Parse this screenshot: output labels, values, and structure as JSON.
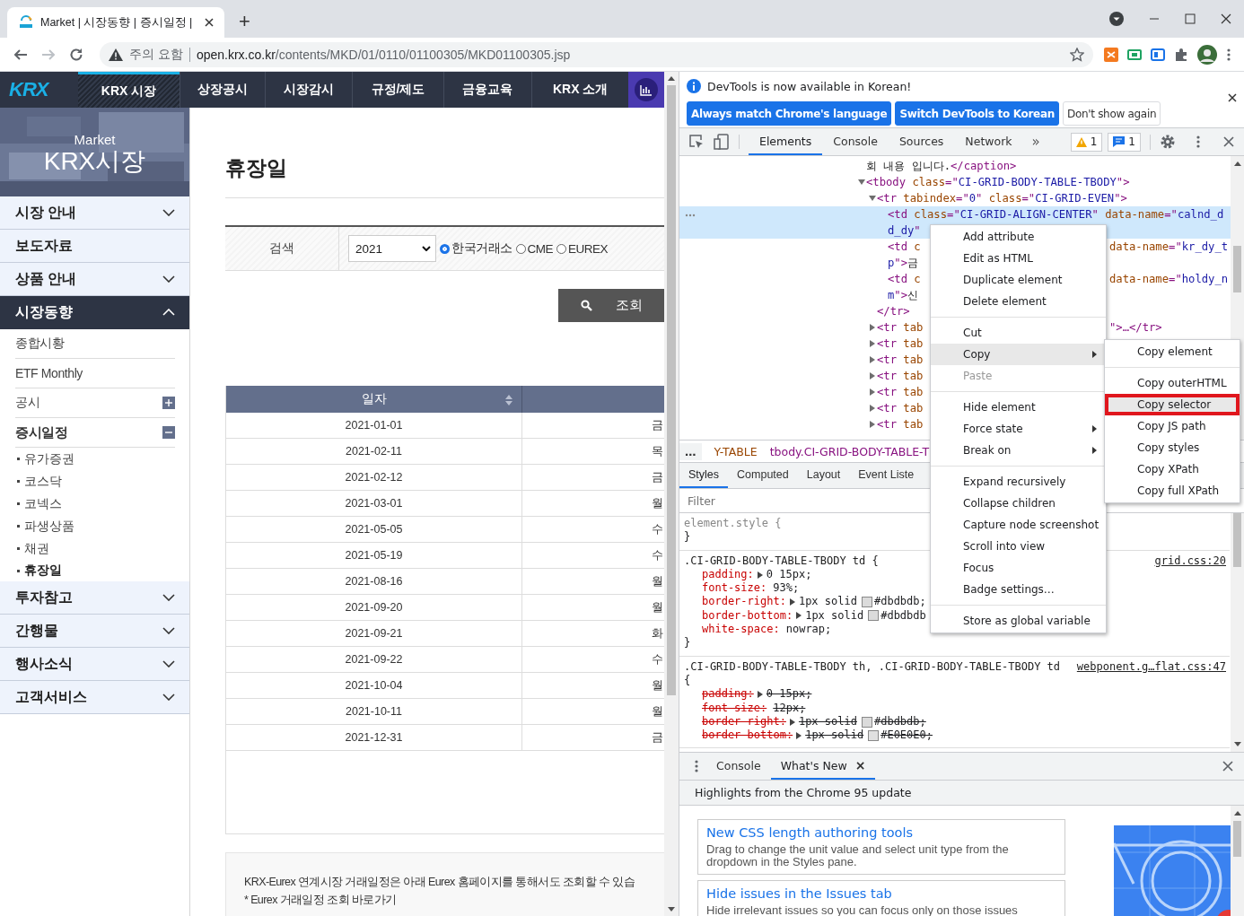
{
  "browser": {
    "tab": {
      "title": "Market | 시장동향 | 증시일정 |"
    },
    "new_tab": "+",
    "forward": {
      "disabled": true
    },
    "address": {
      "security": "주의 요함",
      "host": "open.krx.co.kr",
      "path": "/contents/MKD/01/0110/01100305/MKD01100305.jsp"
    }
  },
  "site": {
    "logo": "KRX",
    "nav": [
      {
        "label": "KRX 시장",
        "selected": true
      },
      {
        "label": "상장공시",
        "selected": false
      },
      {
        "label": "시장감시",
        "selected": false
      },
      {
        "label": "규정/제도",
        "selected": false
      },
      {
        "label": "금융교육",
        "selected": false
      },
      {
        "label": "KRX 소개",
        "selected": false
      }
    ],
    "banner": {
      "subtitle": "Market",
      "title": "KRX시장"
    },
    "sidebar": [
      {
        "label": "시장 안내",
        "expanded": false
      },
      {
        "label": "보도자료"
      },
      {
        "label": "상품 안내",
        "expanded": false
      },
      {
        "label": "시장동향",
        "expanded": true,
        "children": [
          {
            "label": "종합시황"
          },
          {
            "label": "ETF Monthly"
          },
          {
            "label": "공시",
            "expanded": false
          },
          {
            "label": "증시일정",
            "expanded": true,
            "children": [
              {
                "label": "유가증권",
                "selected": false
              },
              {
                "label": "코스닥",
                "selected": false
              },
              {
                "label": "코넥스",
                "selected": false
              },
              {
                "label": "파생상품",
                "selected": false
              },
              {
                "label": "채권",
                "selected": false
              },
              {
                "label": "휴장일",
                "selected": true
              }
            ]
          }
        ]
      },
      {
        "label": "투자참고",
        "expanded": false
      },
      {
        "label": "간행물",
        "expanded": false
      },
      {
        "label": "행사소식",
        "expanded": false
      },
      {
        "label": "고객서비스",
        "expanded": false
      }
    ],
    "heading": "휴장일",
    "search": {
      "label": "검색",
      "year": "2021",
      "markets": [
        {
          "label": "한국거래소",
          "selected": true
        },
        {
          "label": "CME",
          "selected": false
        },
        {
          "label": "EUREX",
          "selected": false
        }
      ],
      "button": "조회"
    },
    "table": {
      "columns": [
        "일자"
      ],
      "rows": [
        {
          "date": "2021-01-01",
          "column_2": "금"
        },
        {
          "date": "2021-02-11",
          "column_2": "목"
        },
        {
          "date": "2021-02-12",
          "column_2": "금"
        },
        {
          "date": "2021-03-01",
          "column_2": "월"
        },
        {
          "date": "2021-05-05",
          "column_2": "수"
        },
        {
          "date": "2021-05-19",
          "column_2": "수"
        },
        {
          "date": "2021-08-16",
          "column_2": "월"
        },
        {
          "date": "2021-09-20",
          "column_2": "월"
        },
        {
          "date": "2021-09-21",
          "column_2": "화"
        },
        {
          "date": "2021-09-22",
          "column_2": "수"
        },
        {
          "date": "2021-10-04",
          "column_2": "월"
        },
        {
          "date": "2021-10-11",
          "column_2": "월"
        },
        {
          "date": "2021-12-31",
          "column_2": "금"
        }
      ]
    },
    "notice": [
      "KRX-Eurex 연계시장 거래일정은 아래 Eurex 홈페이지를 통해서도 조회할 수 있습",
      "* Eurex 거래일정 조회 바로가기"
    ]
  },
  "devtools": {
    "infobar": {
      "message": "DevTools is now available in Korean!",
      "buttons": [
        {
          "label": "Always match Chrome's language",
          "kind": "primary"
        },
        {
          "label": "Switch DevTools to Korean",
          "kind": "primary"
        },
        {
          "label": "Don't show again",
          "kind": "secondary"
        }
      ]
    },
    "tabs": [
      {
        "label": "Elements",
        "selected": true
      },
      {
        "label": "Console",
        "selected": false
      },
      {
        "label": "Sources",
        "selected": false
      },
      {
        "label": "Network",
        "selected": false
      }
    ],
    "more": "»",
    "warnings": "1",
    "messages": "1",
    "dom": [
      {
        "selected": false,
        "lines": [
          {
            "parts": [
              {
                "text": "회 내용 입니다.",
                "kind": "text"
              },
              {
                "text": "</caption>",
                "kind": "tag"
              }
            ]
          }
        ]
      },
      {
        "selected": false,
        "expanded": true,
        "lines": [
          {
            "parts": [
              {
                "text": "<tbody ",
                "kind": "tag"
              },
              {
                "text": "class",
                "kind": "attr"
              },
              {
                "text": "=\"",
                "kind": "tag"
              },
              {
                "text": "CI-GRID-BODY-TABLE-TBODY",
                "kind": "value"
              },
              {
                "text": "\">",
                "kind": "tag"
              }
            ]
          }
        ],
        "children": [
          {
            "selected": false,
            "expanded": true,
            "lines": [
              {
                "parts": [
                  {
                    "text": "<tr ",
                    "kind": "tag"
                  },
                  {
                    "text": "tabindex",
                    "kind": "attr"
                  },
                  {
                    "text": "=\"",
                    "kind": "tag"
                  },
                  {
                    "text": "0",
                    "kind": "value"
                  },
                  {
                    "text": "\" ",
                    "kind": "tag"
                  },
                  {
                    "text": "class",
                    "kind": "attr"
                  },
                  {
                    "text": "=\"",
                    "kind": "tag"
                  },
                  {
                    "text": "CI-GRID-EVEN",
                    "kind": "value"
                  },
                  {
                    "text": "\">",
                    "kind": "tag"
                  }
                ]
              }
            ],
            "children": [
              {
                "selected": true,
                "lines": [
                  {
                    "parts": [
                      {
                        "text": "<td ",
                        "kind": "tag"
                      },
                      {
                        "text": "class",
                        "kind": "attr"
                      },
                      {
                        "text": "=\"",
                        "kind": "tag"
                      },
                      {
                        "text": "CI-GRID-ALIGN-CENTER",
                        "kind": "value"
                      },
                      {
                        "text": "\" ",
                        "kind": "tag"
                      },
                      {
                        "text": "data-name",
                        "kind": "attr"
                      },
                      {
                        "text": "=\"",
                        "kind": "tag"
                      },
                      {
                        "text": "calnd_d",
                        "kind": "value"
                      }
                    ]
                  },
                  {
                    "parts": [
                      {
                        "text": "d_dy",
                        "kind": "value"
                      },
                      {
                        "text": "\"",
                        "kind": "tag"
                      }
                    ]
                  }
                ]
              },
              {
                "selected": false,
                "lines": [
                  {
                    "parts": [
                      {
                        "text": "<td ",
                        "kind": "tag"
                      },
                      {
                        "text": "c",
                        "kind": "attr"
                      }
                    ],
                    "right": [
                      {
                        "text": "data-name",
                        "kind": "attr"
                      },
                      {
                        "text": "=\"",
                        "kind": "tag"
                      },
                      {
                        "text": "kr_dy_t",
                        "kind": "value"
                      }
                    ]
                  },
                  {
                    "parts": [
                      {
                        "text": "p",
                        "kind": "value"
                      },
                      {
                        "text": "\">",
                        "kind": "tag"
                      },
                      {
                        "text": "금",
                        "kind": "text"
                      }
                    ]
                  }
                ]
              },
              {
                "selected": false,
                "lines": [
                  {
                    "parts": [
                      {
                        "text": "<td ",
                        "kind": "tag"
                      },
                      {
                        "text": "c",
                        "kind": "attr"
                      }
                    ],
                    "right": [
                      {
                        "text": "data-name",
                        "kind": "attr"
                      },
                      {
                        "text": "=\"",
                        "kind": "tag"
                      },
                      {
                        "text": "holdy_n",
                        "kind": "value"
                      }
                    ]
                  },
                  {
                    "parts": [
                      {
                        "text": "m",
                        "kind": "value"
                      },
                      {
                        "text": "\">",
                        "kind": "tag"
                      },
                      {
                        "text": "신",
                        "kind": "text"
                      }
                    ]
                  }
                ]
              }
            ],
            "close": [
              {
                "text": "</tr>",
                "kind": "tag"
              }
            ]
          },
          {
            "selected": false,
            "expanded": false,
            "lines": [
              {
                "parts": [
                  {
                    "text": "<tr ",
                    "kind": "tag"
                  },
                  {
                    "text": "tab",
                    "kind": "attr"
                  }
                ],
                "right": [
                  {
                    "text": "\">…</tr>",
                    "kind": "tag"
                  }
                ]
              }
            ]
          },
          {
            "selected": false,
            "expanded": false,
            "lines": [
              {
                "parts": [
                  {
                    "text": "<tr ",
                    "kind": "tag"
                  },
                  {
                    "text": "tab",
                    "kind": "attr"
                  }
                ]
              }
            ]
          },
          {
            "selected": false,
            "expanded": false,
            "lines": [
              {
                "parts": [
                  {
                    "text": "<tr ",
                    "kind": "tag"
                  },
                  {
                    "text": "tab",
                    "kind": "attr"
                  }
                ]
              }
            ]
          },
          {
            "selected": false,
            "expanded": false,
            "lines": [
              {
                "parts": [
                  {
                    "text": "<tr ",
                    "kind": "tag"
                  },
                  {
                    "text": "tab",
                    "kind": "attr"
                  }
                ]
              }
            ]
          },
          {
            "selected": false,
            "expanded": false,
            "lines": [
              {
                "parts": [
                  {
                    "text": "<tr ",
                    "kind": "tag"
                  },
                  {
                    "text": "tab",
                    "kind": "attr"
                  }
                ]
              }
            ]
          },
          {
            "selected": false,
            "expanded": false,
            "lines": [
              {
                "parts": [
                  {
                    "text": "<tr ",
                    "kind": "tag"
                  },
                  {
                    "text": "tab",
                    "kind": "attr"
                  }
                ]
              }
            ]
          },
          {
            "selected": false,
            "expanded": false,
            "lines": [
              {
                "parts": [
                  {
                    "text": "<tr ",
                    "kind": "tag"
                  },
                  {
                    "text": "tab",
                    "kind": "attr"
                  }
                ]
              }
            ]
          }
        ]
      }
    ],
    "breadcrumb": [
      "…",
      "Y-TABLE",
      "tbody.CI-GRID-BODY-TABLE-T"
    ],
    "style_tabs": [
      {
        "label": "Styles",
        "selected": true
      },
      {
        "label": "Computed",
        "selected": false
      },
      {
        "label": "Layout",
        "selected": false
      },
      {
        "label": "Event Liste",
        "selected": false
      }
    ],
    "filter": {
      "placeholder": "Filter"
    },
    "rules": [
      {
        "selector": "element.style {",
        "close": "}"
      },
      {
        "selector": ".CI-GRID-BODY-TABLE-TBODY td {",
        "source": "grid.css:20",
        "props": [
          {
            "name": "padding:",
            "expandable": true,
            "value": "0 15px;",
            "overridden": false
          },
          {
            "name": "font-size:",
            "expandable": false,
            "value": "93%;",
            "overridden": false
          },
          {
            "name": "border-right:",
            "expandable": true,
            "value": "1px solid",
            "color_value": "#dbdbdb;",
            "overridden": false
          },
          {
            "name": "border-bottom:",
            "expandable": true,
            "value": "1px solid",
            "color_value": "#dbdbdb",
            "overridden": false
          },
          {
            "name": "white-space:",
            "expandable": false,
            "value": "nowrap;",
            "overridden": false
          }
        ],
        "close": "}"
      },
      {
        "selector": ".CI-GRID-BODY-TABLE-TBODY th, .CI-GRID-BODY-TABLE-TBODY td",
        "source": "webponent.g…flat.css:47",
        "open": "{",
        "props": [
          {
            "name": "padding:",
            "expandable": true,
            "value": "0 15px;",
            "overridden": true
          },
          {
            "name": "font-size:",
            "expandable": false,
            "value": "12px;",
            "overridden": true
          },
          {
            "name": "border-right:",
            "expandable": true,
            "value": "1px solid",
            "color_value": "#dbdbdb;",
            "overridden": true
          },
          {
            "name": "border-bottom:",
            "expandable": true,
            "value": "1px solid",
            "color_value": "#E0E0E0;",
            "overridden": true
          }
        ]
      }
    ],
    "context_menu": {
      "groups": [
        [
          {
            "label": "Add attribute",
            "selected": false
          },
          {
            "label": "Edit as HTML",
            "selected": false
          },
          {
            "label": "Duplicate element",
            "selected": false
          },
          {
            "label": "Delete element",
            "selected": false
          }
        ],
        [
          {
            "label": "Cut",
            "selected": false
          },
          {
            "label": "Copy",
            "selected": true,
            "submenu": true
          },
          {
            "label": "Paste",
            "selected": false,
            "disabled": true
          }
        ],
        [
          {
            "label": "Hide element",
            "selected": false
          },
          {
            "label": "Force state",
            "selected": false,
            "submenu": true
          },
          {
            "label": "Break on",
            "selected": false,
            "submenu": true
          }
        ],
        [
          {
            "label": "Expand recursively",
            "selected": false
          },
          {
            "label": "Collapse children",
            "selected": false
          },
          {
            "label": "Capture node screenshot",
            "selected": false
          },
          {
            "label": "Scroll into view",
            "selected": false
          },
          {
            "label": "Focus",
            "selected": false
          },
          {
            "label": "Badge settings…",
            "selected": false
          }
        ],
        [
          {
            "label": "Store as global variable",
            "selected": false
          }
        ]
      ],
      "submenu": [
        [
          {
            "label": "Copy element",
            "selected": false
          }
        ],
        [
          {
            "label": "Copy outerHTML",
            "selected": false
          },
          {
            "label": "Copy selector",
            "selected": true,
            "outlined": true
          },
          {
            "label": "Copy JS path",
            "selected": false
          },
          {
            "label": "Copy styles",
            "selected": false
          },
          {
            "label": "Copy XPath",
            "selected": false
          },
          {
            "label": "Copy full XPath",
            "selected": false
          }
        ]
      ]
    },
    "drawer": {
      "tabs": [
        {
          "label": "Console",
          "selected": false,
          "closable": false
        },
        {
          "label": "What's New",
          "selected": true,
          "closable": true
        }
      ],
      "close_tab": "×",
      "heading": "Highlights from the Chrome 95 update",
      "cards": [
        {
          "title": "New CSS length authoring tools",
          "text": "Drag to change the unit value and select unit type from the dropdown in the Styles pane."
        },
        {
          "title": "Hide issues in the Issues tab",
          "text": "Hide irrelevant issues so you can focus only on those issues"
        }
      ]
    }
  }
}
